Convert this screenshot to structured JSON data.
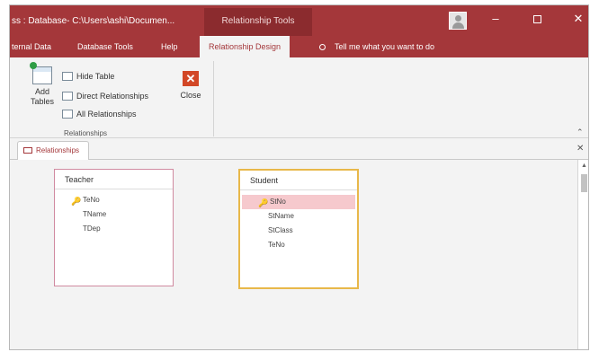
{
  "window": {
    "doc_title": "ss : Database- C:\\Users\\ashi\\Documen...",
    "context_tab": "Relationship Tools",
    "minimize_glyph": "–",
    "close_glyph": "✕"
  },
  "ribbon_tabs": [
    {
      "label": "ternal Data"
    },
    {
      "label": "Database Tools"
    },
    {
      "label": "Help"
    },
    {
      "label": "Relationship Design",
      "active": true
    }
  ],
  "tell_me": "Tell me what you want to do",
  "ribbon": {
    "add_tables": {
      "line1": "Add",
      "line2": "Tables"
    },
    "hide_table": "Hide Table",
    "direct_relationships": "Direct Relationships",
    "all_relationships": "All Relationships",
    "close": "Close",
    "close_glyph": "✕",
    "group_label": "Relationships",
    "collapse_glyph": "⌃"
  },
  "doc_tab": {
    "label": "Relationships",
    "close_glyph": "✕"
  },
  "tables": [
    {
      "name": "Teacher",
      "fields": [
        "TeNo",
        "TName",
        "TDep"
      ],
      "primary_key": "TeNo"
    },
    {
      "name": "Student",
      "fields": [
        "StNo",
        "StName",
        "StClass",
        "TeNo"
      ],
      "primary_key": "StNo",
      "selected_field": "StNo"
    }
  ],
  "key_glyph": "🔑",
  "scroll_up_glyph": "▲",
  "colors": {
    "accent": "#a4373a",
    "canvas": "#f3f3f3",
    "selected_table_border": "#e8b84a",
    "table_border": "#d08aa0",
    "selected_field": "#f6c9cd"
  }
}
